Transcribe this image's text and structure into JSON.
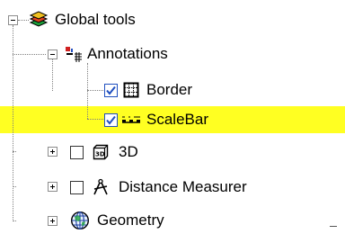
{
  "tree": {
    "root": {
      "label": "Global tools",
      "icon": "layers-icon",
      "expanded": true
    },
    "annotations": {
      "label": "Annotations",
      "icon": "annotation-group-icon",
      "expanded": true
    },
    "border": {
      "label": "Border",
      "icon": "grid-border-icon",
      "checked": true
    },
    "scalebar": {
      "label": "ScaleBar",
      "icon": "scalebar-icon",
      "checked": true,
      "highlighted": true
    },
    "three_d": {
      "label": "3D",
      "icon": "3d-box-icon",
      "checked": false,
      "expanded": false
    },
    "distance": {
      "label": "Distance Measurer",
      "icon": "compass-measure-icon",
      "checked": false,
      "expanded": false
    },
    "geometry": {
      "label": "Geometry",
      "icon": "globe-geometry-icon",
      "expanded": false
    }
  },
  "colors": {
    "highlight": "#ffff22",
    "check": "#1f4fbf",
    "tree_lines": "#808080"
  }
}
